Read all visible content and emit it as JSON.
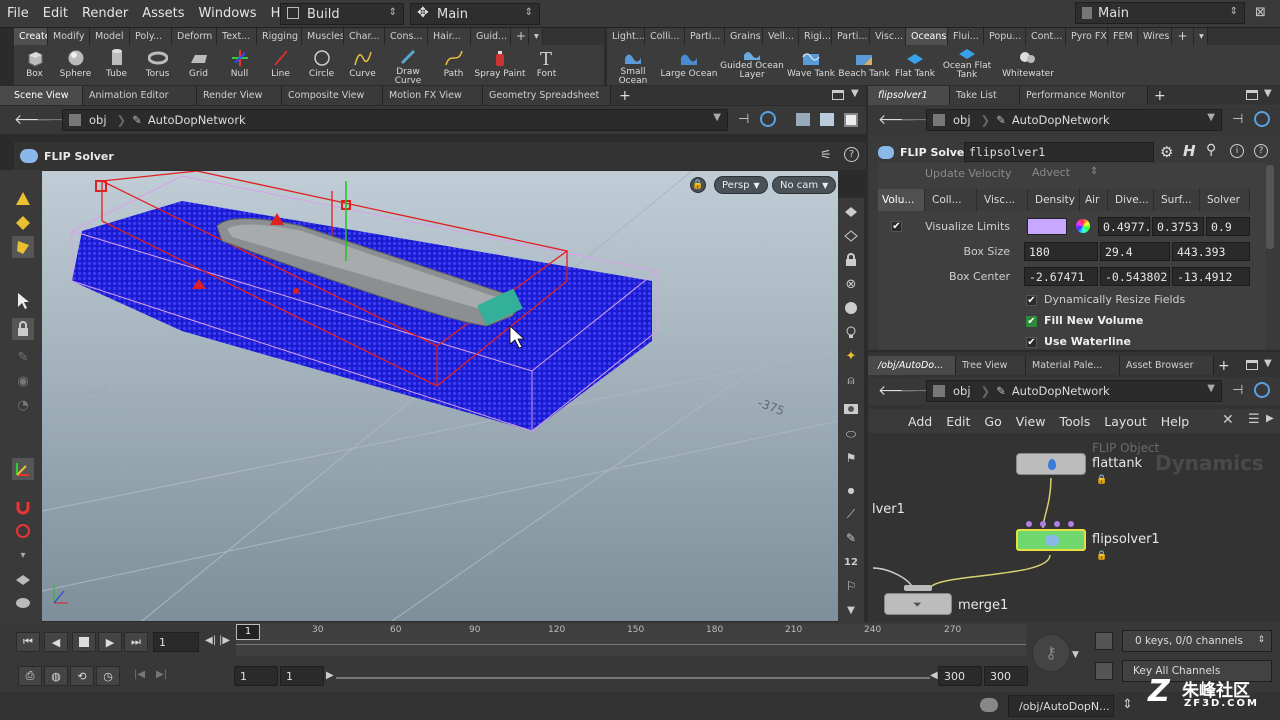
{
  "menu": [
    "File",
    "Edit",
    "Render",
    "Assets",
    "Windows",
    "Help"
  ],
  "desktop_select": "Build",
  "context_select": "Main",
  "workspace_select": "Main",
  "shelf_tabs_left": [
    "Create",
    "Modify",
    "Model",
    "Poly...",
    "Deform",
    "Text...",
    "Rigging",
    "Muscles",
    "Char...",
    "Cons...",
    "Hair...",
    "Guid..."
  ],
  "shelf_tabs_right": [
    "Light...",
    "Colli...",
    "Parti...",
    "Grains",
    "Vell...",
    "Rigi...",
    "Parti...",
    "Visc...",
    "Oceans",
    "Flui...",
    "Popu...",
    "Cont...",
    "Pyro FX",
    "FEM",
    "Wires"
  ],
  "tools_left": [
    "Box",
    "Sphere",
    "Tube",
    "Torus",
    "Grid",
    "Null",
    "Line",
    "Circle",
    "Curve",
    "Draw Curve",
    "Path",
    "Spray Paint",
    "Font"
  ],
  "tools_right": [
    "Small Ocean",
    "Large Ocean",
    "Guided Ocean Layer",
    "Wave Tank",
    "Beach Tank",
    "Flat Tank",
    "Ocean Flat Tank",
    "Whitewater"
  ],
  "left_tabs": [
    "Scene View",
    "Animation Editor",
    "Render View",
    "Composite View",
    "Motion FX View",
    "Geometry Spreadsheet"
  ],
  "left_path": {
    "root": "obj",
    "node": "AutoDopNetwork"
  },
  "viewport": {
    "title": "FLIP Solver",
    "camera": "Persp",
    "cam": "No cam"
  },
  "param_tabs": [
    "flipsolver1",
    "Take List",
    "Performance Monitor"
  ],
  "param_path": {
    "root": "obj",
    "node": "AutoDopNetwork"
  },
  "param": {
    "type": "FLIP Solver",
    "name": "flipsolver1",
    "buttons": [
      "Update Velocity",
      "Advect"
    ],
    "tabs": [
      "Volu...",
      "Coll...",
      "Visc...",
      "Density",
      "Air",
      "Dive...",
      "Surf...",
      "Solver"
    ],
    "visualize_limits_label": "Visualize Limits",
    "color_values": [
      "0.4977...",
      "0.3753",
      "0.9"
    ],
    "box_size_label": "Box Size",
    "box_size": [
      "180",
      "29.4",
      "443.393"
    ],
    "box_center_label": "Box Center",
    "box_center": [
      "-2.67471",
      "-0.543802",
      "-13.4912"
    ],
    "dyn_resize": "Dynamically Resize Fields",
    "fill_new_volume": "Fill New Volume",
    "use_waterline": "Use Waterline"
  },
  "net_tabs": [
    "/obj/AutoDo...",
    "Tree View",
    "Material Pale...",
    "Asset Browser"
  ],
  "net_path": {
    "root": "obj",
    "node": "AutoDopNetwork"
  },
  "net_menu": [
    "Add",
    "Edit",
    "Go",
    "View",
    "Tools",
    "Layout",
    "Help"
  ],
  "net": {
    "dynamics_watermark": "Dynamics",
    "flattank_type": "FLIP Object",
    "flattank": "flattank",
    "flipsolver": "flipsolver1",
    "merge": "merge1",
    "partial": "lver1"
  },
  "timeline": {
    "current_frame": "1",
    "marker": "1",
    "ticks": [
      "30",
      "60",
      "90",
      "120",
      "150",
      "180",
      "210",
      "240",
      "270"
    ],
    "start": "1",
    "start2": "1",
    "end": "300",
    "end2": "300",
    "keys": "0 keys, 0/0 channels",
    "key_all": "Key All Channels"
  },
  "status_path": "/obj/AutoDopN...",
  "watermark": {
    "cn": "朱峰社区",
    "url": "ZF3D.COM"
  },
  "colors": {
    "selected_node": "#6ed86e",
    "particles": "#2a2ae0",
    "limits": "#c7a7ff"
  }
}
